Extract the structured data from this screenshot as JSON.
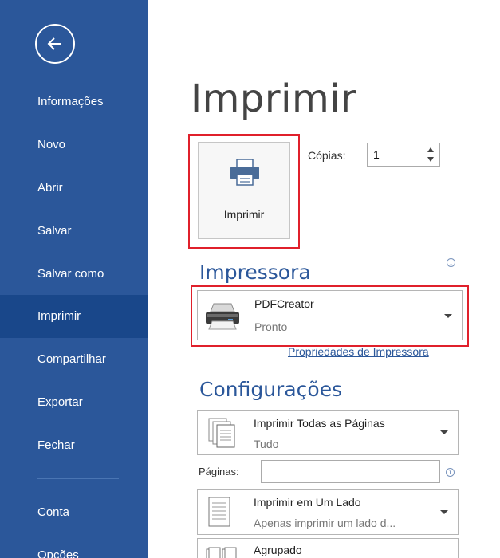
{
  "sidebar": {
    "items": [
      {
        "label": "Informações"
      },
      {
        "label": "Novo"
      },
      {
        "label": "Abrir"
      },
      {
        "label": "Salvar"
      },
      {
        "label": "Salvar como"
      },
      {
        "label": "Imprimir"
      },
      {
        "label": "Compartilhar"
      },
      {
        "label": "Exportar"
      },
      {
        "label": "Fechar"
      },
      {
        "label": "Conta"
      },
      {
        "label": "Opções"
      }
    ],
    "active_item": "Imprimir"
  },
  "page": {
    "title": "Imprimir"
  },
  "print_button": {
    "label": "Imprimir"
  },
  "copies": {
    "label": "Cópias:",
    "value": "1"
  },
  "printer_section": {
    "heading": "Impressora",
    "printer_name": "PDFCreator",
    "printer_status": "Pronto",
    "properties_link": "Propriedades de Impressora"
  },
  "settings_section": {
    "heading": "Configurações",
    "range": {
      "main": "Imprimir Todas as Páginas",
      "sub": "Tudo"
    },
    "pages": {
      "label": "Páginas:",
      "value": ""
    },
    "sides": {
      "main": "Imprimir em Um Lado",
      "sub": "Apenas imprimir um lado d..."
    },
    "collation": {
      "main": "Agrupado"
    }
  },
  "colors": {
    "sidebar_bg": "#2b579a",
    "sidebar_active": "#19478a",
    "highlight_border": "#e0202b",
    "accent": "#2b579a"
  }
}
